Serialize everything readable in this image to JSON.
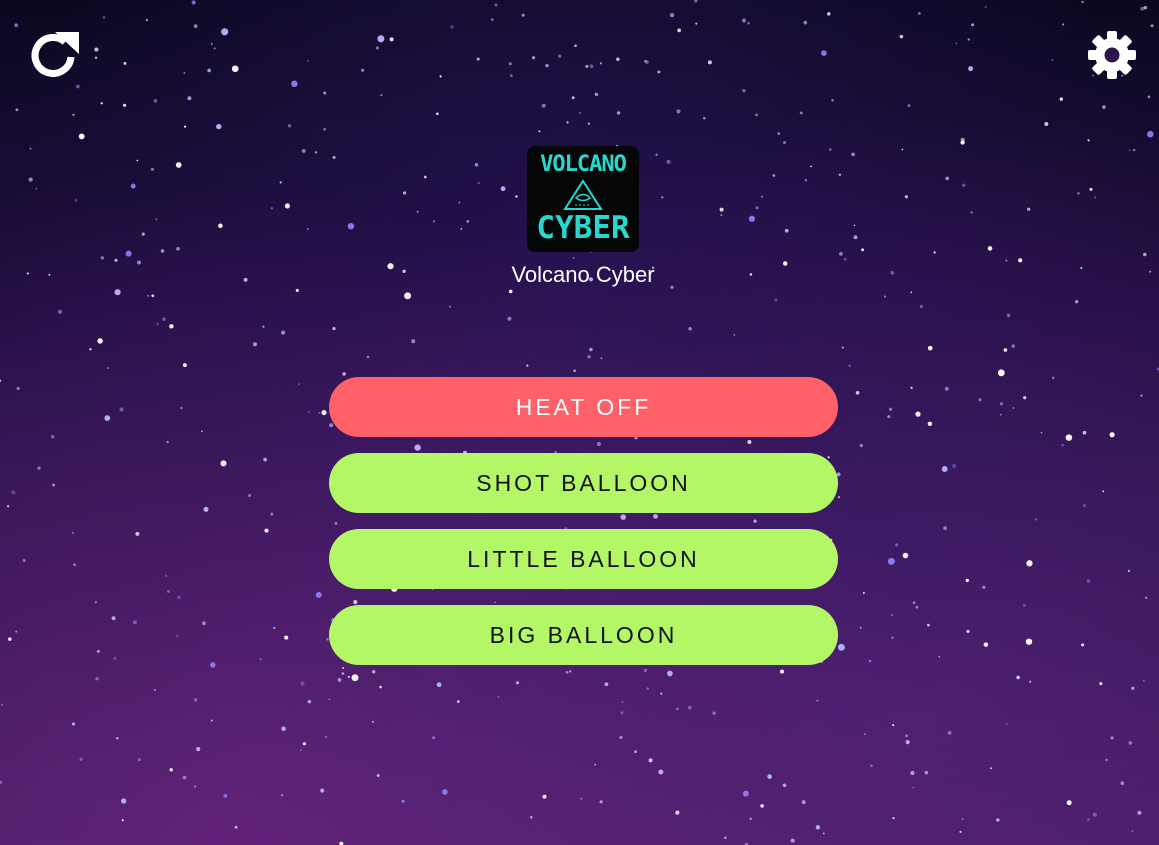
{
  "app": {
    "name": "Volcano Cyber",
    "logo": {
      "line1": "VOLCANO",
      "line2": "CYBER",
      "color": "#28d8cf"
    }
  },
  "toolbar": {
    "refresh_icon": "refresh-icon",
    "settings_icon": "gear-icon"
  },
  "buttons": [
    {
      "label": "HEAT OFF",
      "color": "#fe6268"
    },
    {
      "label": "SHOT BALLOON",
      "color": "#b4f766"
    },
    {
      "label": "LITTLE BALLOON",
      "color": "#b4f766"
    },
    {
      "label": "BIG BALLOON",
      "color": "#b4f766"
    }
  ]
}
